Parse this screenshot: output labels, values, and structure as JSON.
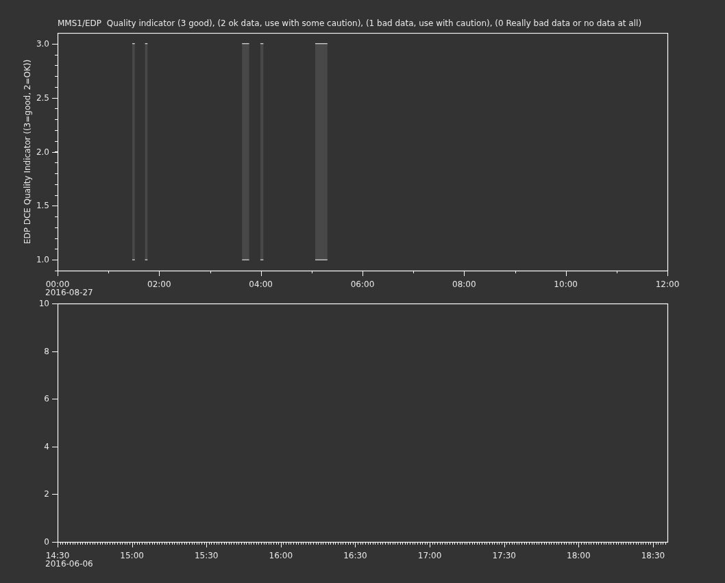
{
  "plots": [
    {
      "chart_data": {
        "type": "bar",
        "title": "MMS1/EDP  Quality indicator (3 good), (2 ok data, use with some caution), (1 bad data, use with caution), (0 Really bad data or no data at all)",
        "ylabel": "EDP DCE Quality Indicator ((3=good, 2=OK))",
        "xlim": [
          0,
          12
        ],
        "ylim": [
          0.9,
          3.1
        ],
        "xticks": [
          {
            "value": 0,
            "label": "00:00"
          },
          {
            "value": 2,
            "label": "02:00"
          },
          {
            "value": 4,
            "label": "04:00"
          },
          {
            "value": 6,
            "label": "06:00"
          },
          {
            "value": 8,
            "label": "08:00"
          },
          {
            "value": 10,
            "label": "10:00"
          },
          {
            "value": 12,
            "label": "12:00"
          }
        ],
        "yticks": [
          {
            "value": 1,
            "label": "1.0"
          },
          {
            "value": 1.5,
            "label": "1.5"
          },
          {
            "value": 2,
            "label": "2.0"
          },
          {
            "value": 2.5,
            "label": "2.5"
          },
          {
            "value": 3,
            "label": "3.0"
          }
        ]
      },
      "date_label": "2016-08-27"
    },
    {
      "chart_data": {
        "type": "line",
        "xlim": [
          14.5,
          18.597
        ],
        "ylim": [
          0,
          10
        ],
        "xticks": [
          {
            "value": 14.5,
            "label": "14:30"
          },
          {
            "value": 15,
            "label": "15:00"
          },
          {
            "value": 15.5,
            "label": "15:30"
          },
          {
            "value": 16,
            "label": "16:00"
          },
          {
            "value": 16.5,
            "label": "16:30"
          },
          {
            "value": 17,
            "label": "17:00"
          },
          {
            "value": 17.5,
            "label": "17:30"
          },
          {
            "value": 18,
            "label": "18:00"
          },
          {
            "value": 18.5,
            "label": "18:30"
          }
        ],
        "yticks": [
          0,
          2,
          4,
          6,
          8,
          10
        ]
      },
      "date_label": "2016-06-06"
    }
  ]
}
